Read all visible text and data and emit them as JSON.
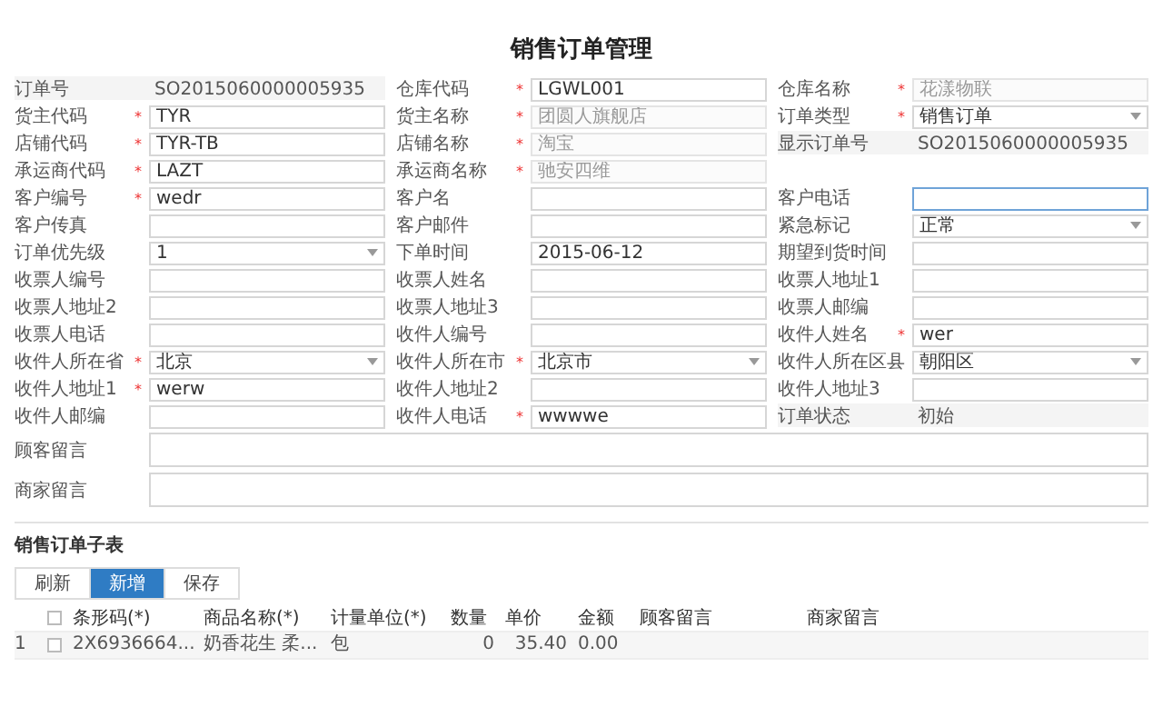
{
  "title": "销售订单管理",
  "form_rows": [
    [
      {
        "label": "订单号",
        "kind": "static",
        "value": "SO2015060000005935"
      },
      {
        "label": "仓库代码",
        "kind": "text",
        "value": "LGWL001",
        "required_mark": "*",
        "disabled": false,
        "focused": false
      },
      {
        "label": "仓库名称",
        "kind": "text",
        "value": "花漾物联",
        "required_mark": "*",
        "disabled": true,
        "focused": false
      }
    ],
    [
      {
        "label": "货主代码",
        "kind": "text",
        "value": "TYR",
        "required_mark": "*",
        "disabled": false,
        "focused": false
      },
      {
        "label": "货主名称",
        "kind": "text",
        "value": "团圆人旗舰店",
        "required_mark": "*",
        "disabled": true,
        "focused": false
      },
      {
        "label": "订单类型",
        "kind": "select",
        "value": "销售订单",
        "required_mark": "*",
        "disabled": false,
        "focused": false
      }
    ],
    [
      {
        "label": "店铺代码",
        "kind": "text",
        "value": "TYR-TB",
        "required_mark": "*",
        "disabled": false,
        "focused": false
      },
      {
        "label": "店铺名称",
        "kind": "text",
        "value": "淘宝",
        "required_mark": "*",
        "disabled": true,
        "focused": false
      },
      {
        "label": "显示订单号",
        "kind": "static",
        "value": "SO2015060000005935"
      }
    ],
    [
      {
        "label": "承运商代码",
        "kind": "text",
        "value": "LAZT",
        "required_mark": "*",
        "disabled": false,
        "focused": false
      },
      {
        "label": "承运商名称",
        "kind": "text",
        "value": "驰安四维",
        "required_mark": "*",
        "disabled": true,
        "focused": false
      },
      {
        "kind": "empty"
      }
    ],
    [
      {
        "label": "客户编号",
        "kind": "text",
        "value": "wedr",
        "required_mark": "*",
        "disabled": false,
        "focused": false
      },
      {
        "label": "客户名",
        "kind": "text",
        "disabled": false,
        "focused": false
      },
      {
        "label": "客户电话",
        "kind": "text",
        "disabled": false,
        "focused": true
      }
    ],
    [
      {
        "label": "客户传真",
        "kind": "text",
        "disabled": false,
        "focused": false
      },
      {
        "label": "客户邮件",
        "kind": "text",
        "disabled": false,
        "focused": false
      },
      {
        "label": "紧急标记",
        "kind": "select",
        "value": "正常",
        "disabled": false,
        "focused": false
      }
    ],
    [
      {
        "label": "订单优先级",
        "kind": "select",
        "value": "1",
        "disabled": false,
        "focused": false
      },
      {
        "label": "下单时间",
        "kind": "text",
        "value": "2015-06-12",
        "disabled": false,
        "focused": false
      },
      {
        "label": "期望到货时间",
        "kind": "text",
        "disabled": false,
        "focused": false
      }
    ],
    [
      {
        "label": "收票人编号",
        "kind": "text",
        "disabled": false,
        "focused": false
      },
      {
        "label": "收票人姓名",
        "kind": "text",
        "disabled": false,
        "focused": false
      },
      {
        "label": "收票人地址1",
        "kind": "text",
        "disabled": false,
        "focused": false
      }
    ],
    [
      {
        "label": "收票人地址2",
        "kind": "text",
        "disabled": false,
        "focused": false
      },
      {
        "label": "收票人地址3",
        "kind": "text",
        "disabled": false,
        "focused": false
      },
      {
        "label": "收票人邮编",
        "kind": "text",
        "disabled": false,
        "focused": false
      }
    ],
    [
      {
        "label": "收票人电话",
        "kind": "text",
        "disabled": false,
        "focused": false
      },
      {
        "label": "收件人编号",
        "kind": "text",
        "disabled": false,
        "focused": false
      },
      {
        "label": "收件人姓名",
        "kind": "text",
        "value": "wer",
        "required_mark": "*",
        "disabled": false,
        "focused": false
      }
    ],
    [
      {
        "label": "收件人所在省",
        "kind": "select",
        "value": "北京",
        "required_mark": "*",
        "disabled": false,
        "focused": false
      },
      {
        "label": "收件人所在市",
        "kind": "select",
        "value": "北京市",
        "required_mark": "*",
        "disabled": false,
        "focused": false
      },
      {
        "label": "收件人所在区县",
        "kind": "select",
        "value": "朝阳区",
        "disabled": false,
        "focused": false
      }
    ],
    [
      {
        "label": "收件人地址1",
        "kind": "text",
        "value": "werw",
        "required_mark": "*",
        "disabled": false,
        "focused": false
      },
      {
        "label": "收件人地址2",
        "kind": "text",
        "disabled": false,
        "focused": false
      },
      {
        "label": "收件人地址3",
        "kind": "text",
        "disabled": false,
        "focused": false
      }
    ],
    [
      {
        "label": "收件人邮编",
        "kind": "text",
        "disabled": false,
        "focused": false
      },
      {
        "label": "收件人电话",
        "kind": "text",
        "value": "wwwwe",
        "required_mark": "*",
        "disabled": false,
        "focused": false
      },
      {
        "label": "订单状态",
        "kind": "static",
        "value": "初始"
      }
    ]
  ],
  "notes": [
    {
      "label": "顾客留言"
    },
    {
      "label": "商家留言"
    }
  ],
  "subtable": {
    "title": "销售订单子表",
    "buttons": [
      {
        "label": "刷新",
        "selected": false
      },
      {
        "label": "新增",
        "selected": true
      },
      {
        "label": "保存",
        "selected": false
      }
    ],
    "columns": [
      "条形码(*)",
      "商品名称(*)",
      "计量单位(*)",
      "数量",
      "单价",
      "金额",
      "顾客留言",
      "商家留言"
    ],
    "header_checked": false,
    "rows": [
      {
        "index": "1",
        "checked": false,
        "cells": [
          "2X6936664...",
          "奶香花生 柔...",
          "包",
          "0",
          "35.40",
          "0.00"
        ]
      }
    ]
  }
}
